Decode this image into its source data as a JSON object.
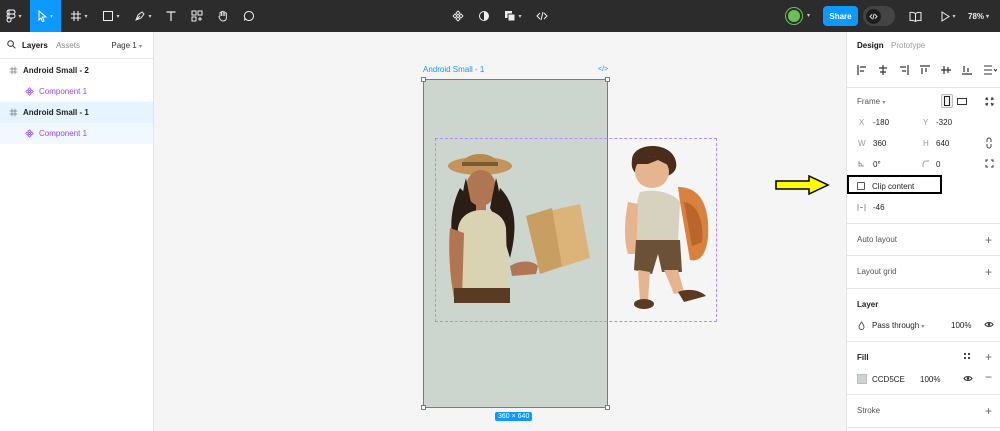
{
  "toolbar": {
    "share_label": "Share",
    "zoom": "78%"
  },
  "left_panel": {
    "tabs": [
      "Layers",
      "Assets"
    ],
    "page_selector": "Page 1",
    "layers": [
      {
        "name": "Android Small - 2",
        "type": "frame"
      },
      {
        "name": "Component 1",
        "type": "component"
      },
      {
        "name": "Android Small - 1",
        "type": "frame",
        "selected": true
      },
      {
        "name": "Component 1",
        "type": "component"
      }
    ]
  },
  "canvas": {
    "frame_label": "Android Small - 1",
    "size_tag": "360 × 640"
  },
  "right_panel": {
    "tabs": [
      "Design",
      "Prototype"
    ],
    "frame_title": "Frame",
    "x_label": "X",
    "x_value": "-180",
    "y_label": "Y",
    "y_value": "-320",
    "w_label": "W",
    "w_value": "360",
    "h_label": "H",
    "h_value": "640",
    "rotation": "0°",
    "radius": "0",
    "clip_content": "Clip content",
    "spacing": "-46",
    "auto_layout": "Auto layout",
    "layout_grid": "Layout grid",
    "layer_title": "Layer",
    "blend_mode": "Pass through",
    "layer_opacity": "100%",
    "fill_title": "Fill",
    "fill_hex": "CCD5CE",
    "fill_opacity": "100%",
    "stroke_title": "Stroke"
  },
  "colors": {
    "accent": "#0d99ff",
    "component": "#9747ff",
    "frame_fill": "#ccd5ce",
    "annotation_arrow": "#ffff00"
  }
}
